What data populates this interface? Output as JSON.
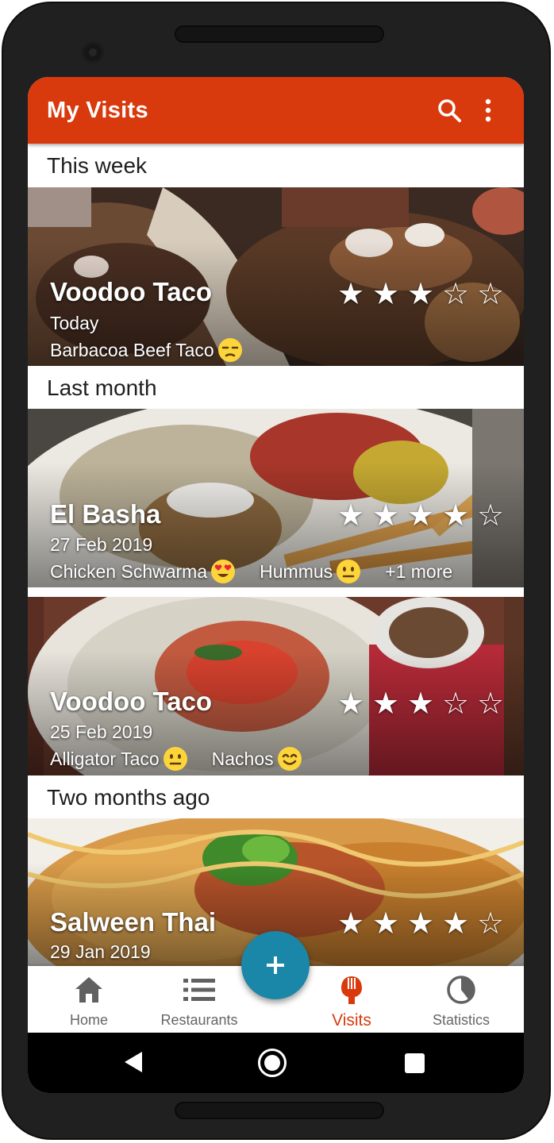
{
  "app_bar": {
    "title": "My Visits",
    "search_icon": "search-icon",
    "menu_icon": "more-vert-icon",
    "color": "#d93a0d"
  },
  "sections": [
    {
      "header": "This week",
      "visits": [
        {
          "restaurant": "Voodoo Taco",
          "date": "Today",
          "rating": 3,
          "max_rating": 5,
          "dishes": [
            {
              "name": "Barbacoa Beef Taco",
              "reaction": "unamused-face"
            }
          ],
          "more": ""
        }
      ]
    },
    {
      "header": "Last month",
      "visits": [
        {
          "restaurant": "El Basha",
          "date": "27 Feb 2019",
          "rating": 4,
          "max_rating": 5,
          "dishes": [
            {
              "name": "Chicken Schwarma",
              "reaction": "heart-eyes-face"
            },
            {
              "name": "Hummus",
              "reaction": "neutral-face"
            }
          ],
          "more": "+1 more"
        },
        {
          "restaurant": "Voodoo Taco",
          "date": "25 Feb 2019",
          "rating": 3,
          "max_rating": 5,
          "dishes": [
            {
              "name": "Alligator Taco",
              "reaction": "neutral-face"
            },
            {
              "name": "Nachos",
              "reaction": "smiling-face"
            }
          ],
          "more": ""
        }
      ]
    },
    {
      "header": "Two months ago",
      "visits": [
        {
          "restaurant": "Salween Thai",
          "date": "29 Jan 2019",
          "rating": 4,
          "max_rating": 5,
          "dishes": [],
          "more": ""
        }
      ]
    }
  ],
  "fab": {
    "icon": "add-icon",
    "color": "#1a86a8"
  },
  "bottom_nav": {
    "items": [
      {
        "label": "Home",
        "icon": "home-icon",
        "active": false
      },
      {
        "label": "Restaurants",
        "icon": "list-icon",
        "active": false
      },
      {
        "label": "Visits",
        "icon": "utensils-icon",
        "active": true
      },
      {
        "label": "Statistics",
        "icon": "pie-chart-icon",
        "active": false
      }
    ],
    "active_color": "#d93a0d"
  },
  "system_nav": {
    "back_icon": "back-icon",
    "home_icon": "home-circle-icon",
    "recents_icon": "recents-icon"
  }
}
